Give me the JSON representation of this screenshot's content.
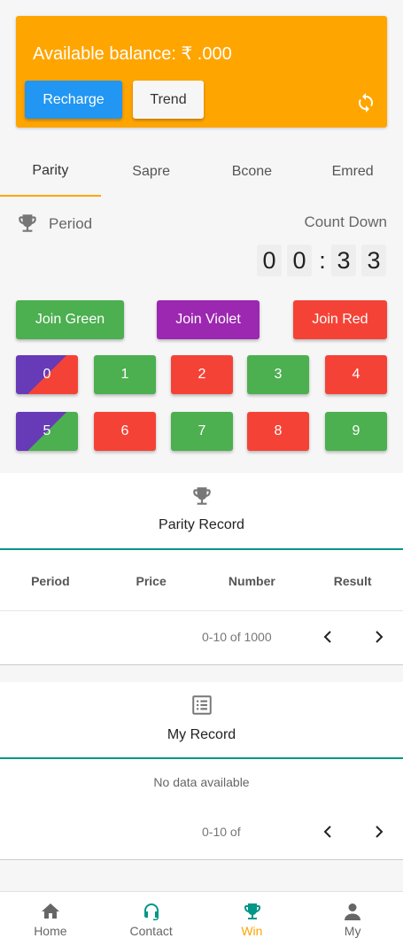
{
  "balance": {
    "text": "Available balance: ₹ .000",
    "recharge_label": "Recharge",
    "trend_label": "Trend"
  },
  "tabs": [
    {
      "label": "Parity",
      "active": true
    },
    {
      "label": "Sapre"
    },
    {
      "label": "Bcone"
    },
    {
      "label": "Emred"
    }
  ],
  "period": {
    "label": "Period",
    "countdown_label": "Count Down",
    "digits": [
      "0",
      "0",
      ":",
      "3",
      "3"
    ]
  },
  "join": {
    "green": "Join Green",
    "violet": "Join Violet",
    "red": "Join Red"
  },
  "numbers": [
    "0",
    "1",
    "2",
    "3",
    "4",
    "5",
    "6",
    "7",
    "8",
    "9"
  ],
  "parity_record": {
    "title": "Parity Record",
    "columns": [
      "Period",
      "Price",
      "Number",
      "Result"
    ],
    "pager": "0-10 of 1000"
  },
  "my_record": {
    "title": "My Record",
    "empty_text": "No data available",
    "pager": "0-10 of"
  },
  "nav": [
    {
      "label": "Home",
      "icon": "home-icon"
    },
    {
      "label": "Contact",
      "icon": "headset-icon"
    },
    {
      "label": "Win",
      "icon": "trophy-icon",
      "active": true
    },
    {
      "label": "My",
      "icon": "person-icon"
    }
  ],
  "colors": {
    "accent": "#ffa500",
    "blue": "#2196f3",
    "green": "#4caf50",
    "violet": "#9c27b0",
    "red": "#f44336",
    "teal": "#009688"
  }
}
